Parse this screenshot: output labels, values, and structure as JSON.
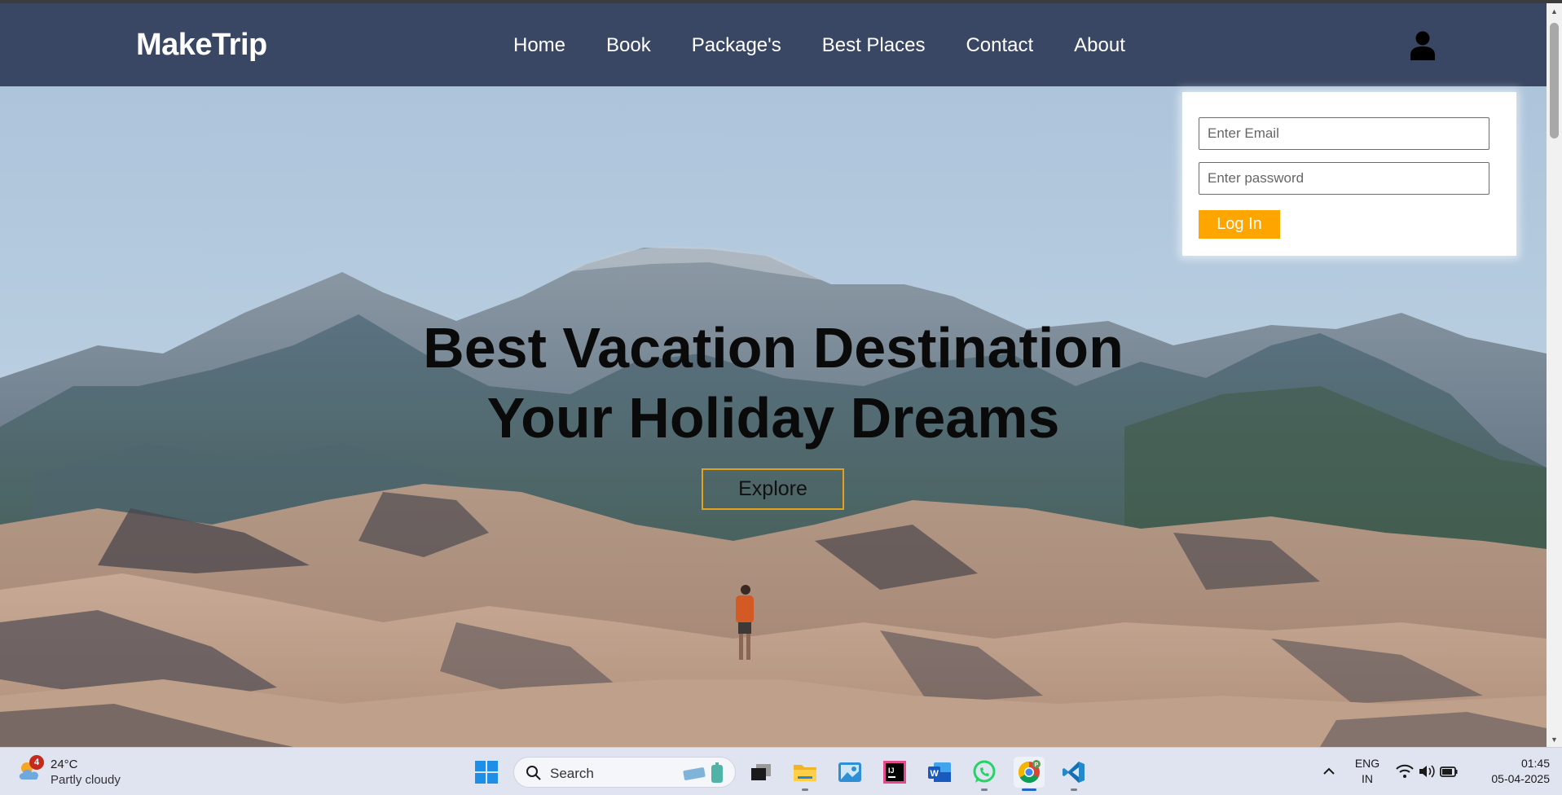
{
  "navbar": {
    "brand": "MakeTrip",
    "links": [
      "Home",
      "Book",
      "Package's",
      "Best Places",
      "Contact",
      "About"
    ],
    "bg_color": "#3a4764"
  },
  "login": {
    "email_placeholder": "Enter Email",
    "password_placeholder": "Enter password",
    "button_label": "Log In",
    "button_color": "#ffa500"
  },
  "hero": {
    "title_line1": "Best Vacation Destination",
    "title_line2": "Your Holiday Dreams",
    "explore_label": "Explore",
    "explore_border_color": "#e3a21c"
  },
  "taskbar": {
    "weather": {
      "badge": "4",
      "temp": "24°C",
      "condition": "Partly cloudy",
      "icon": "partly-cloudy-icon"
    },
    "search_text": "Search",
    "apps": [
      {
        "name": "task-view-icon"
      },
      {
        "name": "file-explorer-icon"
      },
      {
        "name": "photos-app-icon"
      },
      {
        "name": "intellij-idea-icon"
      },
      {
        "name": "microsoft-word-icon"
      },
      {
        "name": "whatsapp-icon"
      },
      {
        "name": "chrome-icon"
      },
      {
        "name": "vscode-icon"
      }
    ],
    "lang_line1": "ENG",
    "lang_line2": "IN",
    "time": "01:45",
    "date": "05-04-2025"
  }
}
